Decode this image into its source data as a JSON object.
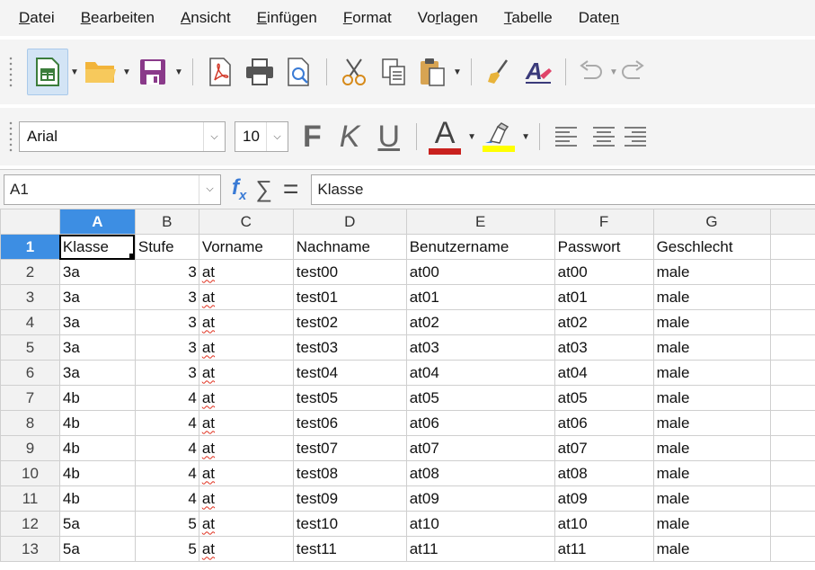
{
  "menu": [
    {
      "pre": "",
      "ul": "D",
      "post": "atei"
    },
    {
      "pre": "",
      "ul": "B",
      "post": "earbeiten"
    },
    {
      "pre": "",
      "ul": "A",
      "post": "nsicht"
    },
    {
      "pre": "",
      "ul": "E",
      "post": "infügen"
    },
    {
      "pre": "",
      "ul": "F",
      "post": "ormat"
    },
    {
      "pre": "Vo",
      "ul": "r",
      "post": "lagen"
    },
    {
      "pre": "",
      "ul": "T",
      "post": "abelle"
    },
    {
      "pre": "Date",
      "ul": "n",
      "post": ""
    }
  ],
  "toolbar2": {
    "font_name": "Arial",
    "font_size": "10",
    "bold_label": "F",
    "italic_label": "K",
    "underline_label": "U",
    "font_color_label": "A",
    "font_color": "#c9211e",
    "highlight_color": "#ffff00"
  },
  "formula_bar": {
    "cell_ref": "A1",
    "content": "Klasse"
  },
  "sheet": {
    "columns": [
      "A",
      "B",
      "C",
      "D",
      "E",
      "F",
      "G"
    ],
    "active_column": "A",
    "active_row": 1,
    "rows": [
      {
        "n": "1",
        "cells": [
          "Klasse",
          "Stufe",
          "Vorname",
          "Nachname",
          "Benutzername",
          "Passwort",
          "Geschlecht"
        ]
      },
      {
        "n": "2",
        "cells": [
          "3a",
          "3",
          "at",
          "test00",
          "at00",
          "at00",
          "male"
        ]
      },
      {
        "n": "3",
        "cells": [
          "3a",
          "3",
          "at",
          "test01",
          "at01",
          "at01",
          "male"
        ]
      },
      {
        "n": "4",
        "cells": [
          "3a",
          "3",
          "at",
          "test02",
          "at02",
          "at02",
          "male"
        ]
      },
      {
        "n": "5",
        "cells": [
          "3a",
          "3",
          "at",
          "test03",
          "at03",
          "at03",
          "male"
        ]
      },
      {
        "n": "6",
        "cells": [
          "3a",
          "3",
          "at",
          "test04",
          "at04",
          "at04",
          "male"
        ]
      },
      {
        "n": "7",
        "cells": [
          "4b",
          "4",
          "at",
          "test05",
          "at05",
          "at05",
          "male"
        ]
      },
      {
        "n": "8",
        "cells": [
          "4b",
          "4",
          "at",
          "test06",
          "at06",
          "at06",
          "male"
        ]
      },
      {
        "n": "9",
        "cells": [
          "4b",
          "4",
          "at",
          "test07",
          "at07",
          "at07",
          "male"
        ]
      },
      {
        "n": "10",
        "cells": [
          "4b",
          "4",
          "at",
          "test08",
          "at08",
          "at08",
          "male"
        ]
      },
      {
        "n": "11",
        "cells": [
          "4b",
          "4",
          "at",
          "test09",
          "at09",
          "at09",
          "male"
        ]
      },
      {
        "n": "12",
        "cells": [
          "5a",
          "5",
          "at",
          "test10",
          "at10",
          "at10",
          "male"
        ]
      },
      {
        "n": "13",
        "cells": [
          "5a",
          "5",
          "at",
          "test11",
          "at11",
          "at11",
          "male"
        ]
      }
    ]
  },
  "icons": [
    "new-spreadsheet-icon",
    "open-folder-icon",
    "save-icon",
    "export-pdf-icon",
    "print-icon",
    "print-preview-icon",
    "cut-icon",
    "copy-icon",
    "paste-icon",
    "clone-formatting-icon",
    "clear-formatting-icon",
    "undo-icon",
    "redo-icon",
    "align-left-icon",
    "align-center-icon",
    "align-right-icon"
  ]
}
